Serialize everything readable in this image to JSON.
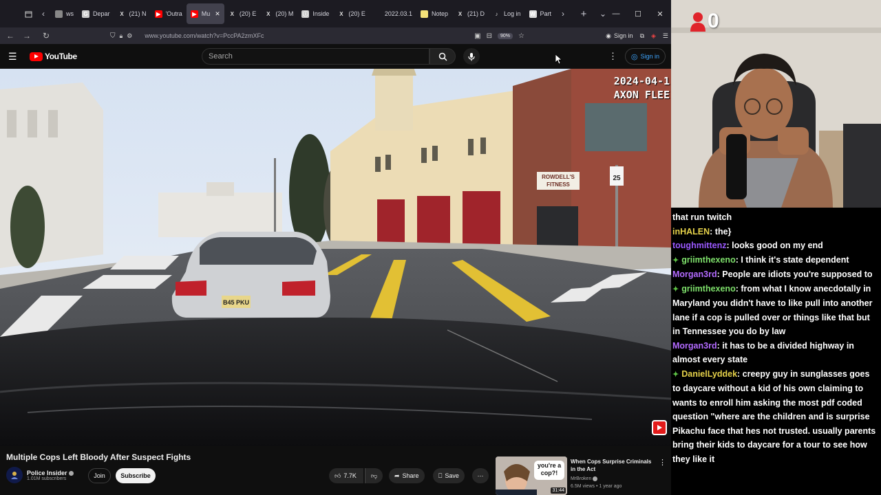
{
  "browser": {
    "tabs": [
      {
        "label": "ws",
        "fav_color": "#888888",
        "fav_glyph": ""
      },
      {
        "label": "Depar",
        "fav_color": "#cccccc",
        "fav_glyph": "G"
      },
      {
        "label": "(21) N",
        "fav_color": "",
        "fav_glyph": "X"
      },
      {
        "label": "'Outra",
        "fav_color": "#ff0000",
        "fav_glyph": "▶"
      },
      {
        "label": "Mu",
        "fav_color": "#ff0000",
        "fav_glyph": "▶",
        "active": true
      },
      {
        "label": "(20) E",
        "fav_color": "",
        "fav_glyph": "X"
      },
      {
        "label": "(20) M",
        "fav_color": "",
        "fav_glyph": "X"
      },
      {
        "label": "Inside",
        "fav_color": "#cccccc",
        "fav_glyph": "ⓘ"
      },
      {
        "label": "(20) E",
        "fav_color": "",
        "fav_glyph": "X"
      },
      {
        "label": "2022.03.1",
        "fav_color": "",
        "fav_glyph": ""
      },
      {
        "label": "Notep",
        "fav_color": "#f4e27a",
        "fav_glyph": ""
      },
      {
        "label": "(21) D",
        "fav_color": "",
        "fav_glyph": "X"
      },
      {
        "label": "Log in",
        "fav_color": "",
        "fav_glyph": "♪"
      },
      {
        "label": "Part",
        "fav_color": "#dddddd",
        "fav_glyph": "W"
      }
    ],
    "url": "www.youtube.com/watch?v=PccPA2zmXFc",
    "zoom": "90%",
    "nav_signin": "Sign in"
  },
  "youtube": {
    "logo_text": "YouTube",
    "search_placeholder": "Search",
    "signin_label": "Sign in"
  },
  "video": {
    "stamp_line1": "2024-04-1",
    "stamp_line2": "AXON FLEE",
    "title": "Multiple Cops Left Bloody After Suspect Fights",
    "channel_name": "Police Insider",
    "subscribers": "1.01M subscribers",
    "join_label": "Join",
    "subscribe_label": "Subscribe",
    "likes": "7.7K",
    "share_label": "Share",
    "save_label": "Save",
    "scene_signs": {
      "fitness_line1": "ROWDELL'S",
      "fitness_line2": "FITNESS",
      "plate": "B45 PKU",
      "speed_limit": "25"
    }
  },
  "recommendation": {
    "title": "When Cops Surprise Criminals in the Act",
    "channel": "MrBroken",
    "meta": "6.5M views • 1 year ago",
    "duration": "31:44",
    "thumb_caption": "you're a cop?!"
  },
  "stream": {
    "counter": "0"
  },
  "chat": [
    {
      "user": "",
      "color": "#ffffff",
      "badge": false,
      "text": "that run twitch"
    },
    {
      "user": "inHALEN",
      "color": "#e6d24a",
      "badge": false,
      "text": ": the}"
    },
    {
      "user": "toughmittenz",
      "color": "#9b59ff",
      "badge": false,
      "text": ": looks good on my end"
    },
    {
      "user": "griimthexeno",
      "color": "#7ee06b",
      "badge": true,
      "text": ": I think it's state dependent"
    },
    {
      "user": "Morgan3rd",
      "color": "#b36bff",
      "badge": false,
      "text": ": People are idiots you're supposed to"
    },
    {
      "user": "griimthexeno",
      "color": "#7ee06b",
      "badge": true,
      "text": ": from what I know anecdotally in Maryland you didn't have to like pull into another lane if a cop is pulled over or things like that but in Tennessee you do by law"
    },
    {
      "user": "Morgan3rd",
      "color": "#b36bff",
      "badge": false,
      "text": ": it has to be a divided highway in almost every state"
    },
    {
      "user": "DanielLyddek",
      "color": "#e6d24a",
      "badge": true,
      "text": ": creepy guy in sunglasses goes to daycare without a kid of his own claiming to wants to enroll him asking the most pdf coded question \"where are the children and is surprise Pikachu face that hes not trusted. usually parents bring their kids to daycare for a tour to see how they like it"
    }
  ]
}
